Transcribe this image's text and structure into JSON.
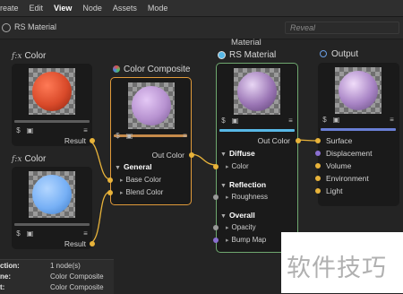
{
  "menu": [
    "reate",
    "Edit",
    "View",
    "Node",
    "Assets",
    "Mode"
  ],
  "menu_active": "View",
  "subbar": {
    "material_name": "RS Material",
    "reveal_placeholder": "Reveal"
  },
  "nodes": {
    "color1": {
      "fx": "f:x",
      "title": "Color",
      "output": "Result",
      "sphere_color": "#d94a2a"
    },
    "color2": {
      "fx": "f:x",
      "title": "Color",
      "output": "Result",
      "sphere_color": "#77b0f5"
    },
    "composite": {
      "title": "Color Composite",
      "output": "Out Color",
      "sphere_color": "#b792d0",
      "group": "General",
      "inputs": [
        "Base Color",
        "Blend Color"
      ]
    },
    "material": {
      "header": "Material",
      "title": "RS Material",
      "output": "Out Color",
      "sphere_color": "#9c77b6",
      "groups": [
        {
          "name": "Diffuse",
          "inputs": [
            "Color"
          ]
        },
        {
          "name": "Reflection",
          "inputs": [
            "Roughness"
          ]
        },
        {
          "name": "Overall",
          "inputs": [
            "Opacity",
            "Bump Map"
          ]
        }
      ]
    },
    "output": {
      "title": "Output",
      "sphere_color": "#a985c6",
      "inputs": [
        "Surface",
        "Displacement",
        "Volume",
        "Environment",
        "Light"
      ]
    }
  },
  "status": [
    {
      "key": "ction:",
      "value": "1 node(s)"
    },
    {
      "key": "ne:",
      "value": "Color Composite"
    },
    {
      "key": "t:",
      "value": "Color Composite"
    }
  ],
  "watermark": "软件技巧",
  "colors": {
    "wire": "#e8b33a",
    "selected_border": "#e09a3a",
    "material_border": "#6fa86f",
    "output_bar": "#6a7fd6",
    "material_bar": "#58b8e6"
  }
}
